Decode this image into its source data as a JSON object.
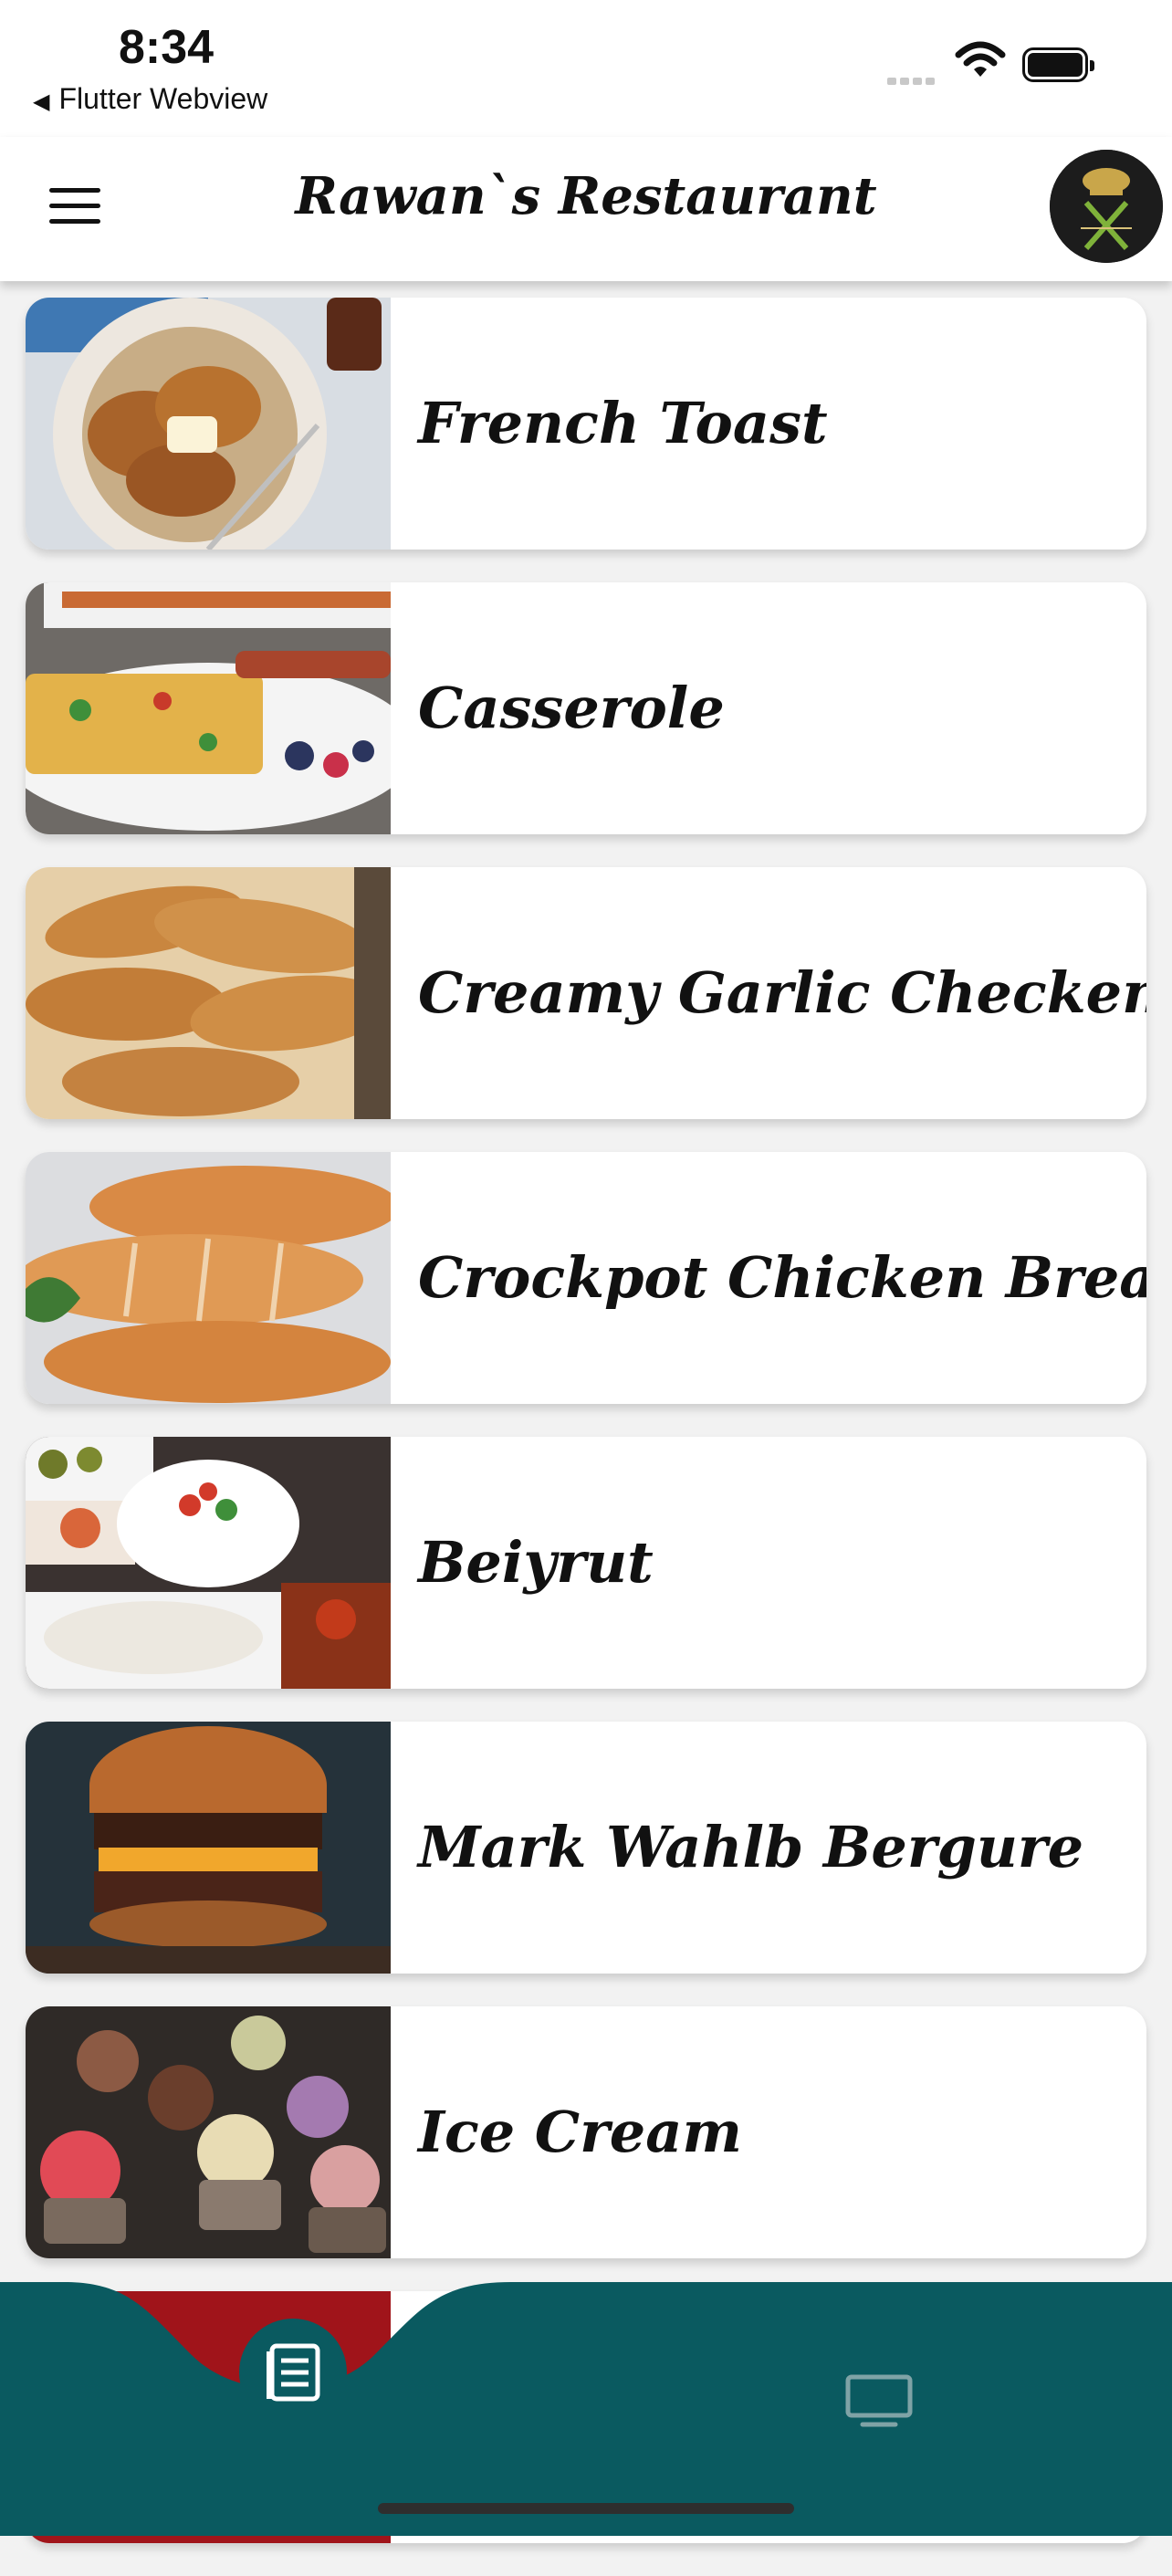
{
  "status_bar": {
    "time": "8:34",
    "back_label": "Flutter Webview"
  },
  "app_bar": {
    "title": "Rawan`s Restaurant"
  },
  "menu": [
    {
      "name": "French Toast",
      "thumb": "french-toast"
    },
    {
      "name": "Casserole",
      "thumb": "casserole"
    },
    {
      "name": "Creamy Garlic Checken",
      "thumb": "garlic-chicken"
    },
    {
      "name": "Crockpot Chicken Breasts",
      "thumb": "chicken-breasts"
    },
    {
      "name": "Beiyrut",
      "thumb": "beiyrut"
    },
    {
      "name": "Mark Wahlb Bergure",
      "thumb": "burger"
    },
    {
      "name": "Ice Cream",
      "thumb": "ice-cream"
    },
    {
      "name": "",
      "thumb": "partial"
    }
  ],
  "colors": {
    "nav_bg": "#0a5a60",
    "card_bg": "#ffffff",
    "page_bg": "#f2f2f2"
  },
  "icons": {
    "menu": "hamburger-icon",
    "home": "document-icon",
    "tv": "monitor-icon"
  }
}
